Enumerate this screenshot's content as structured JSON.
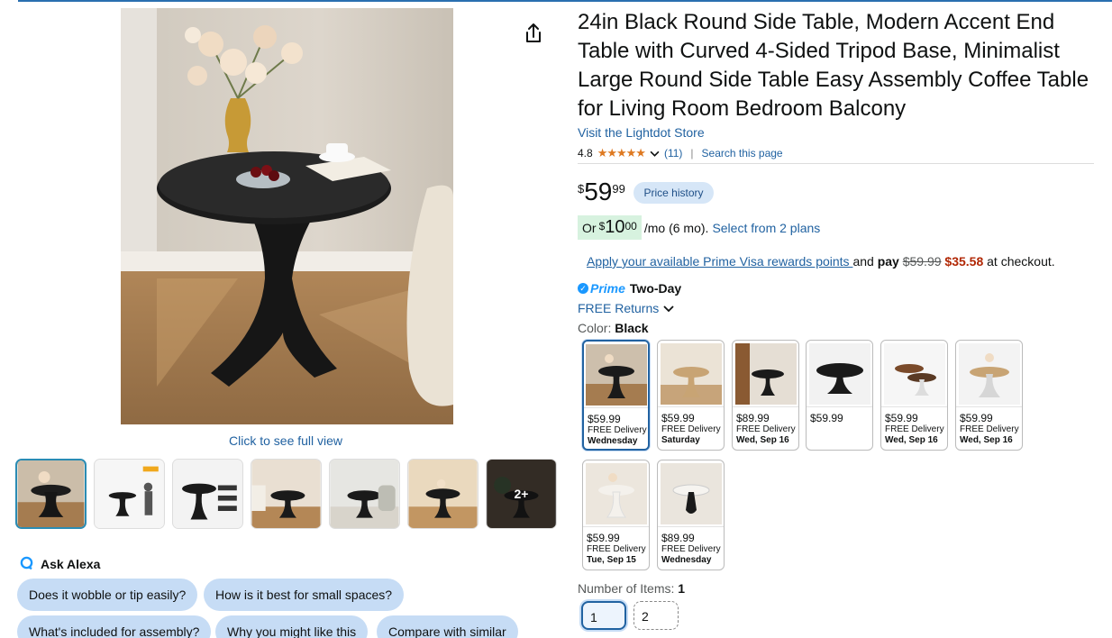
{
  "product": {
    "title": "24in Black Round Side Table, Modern Accent End Table with Curved 4-Sided Tripod Base, Minimalist Large Round Side Table Easy Assembly Coffee Table for Living Room Bedroom Balcony",
    "store_link": "Visit the Lightdot Store",
    "rating": "4.8",
    "stars": "★★★★★",
    "review_count": "(11)",
    "search_page": "Search this page",
    "price_symbol": "$",
    "price_whole": "59",
    "price_fraction": "99",
    "price_history": "Price history",
    "monthly_prefix": "Or",
    "monthly_symbol": "$",
    "monthly_whole": "10",
    "monthly_fraction": "00",
    "monthly_suffix": "/mo (6 mo).",
    "plans_link": "Select from 2 plans",
    "visa_link": "Apply your available Prime Visa rewards points ",
    "visa_and": "and ",
    "visa_pay": "pay",
    "visa_old": "$59.99",
    "visa_new": "$35.58",
    "visa_suffix": " at checkout.",
    "prime_label": "Prime",
    "prime_speed": "Two-Day",
    "returns": "FREE Returns",
    "color_label": "Color: ",
    "color_value": "Black",
    "items_label": "Number of Items: ",
    "items_value": "1"
  },
  "gallery": {
    "full_view": "Click to see full view",
    "more_label": "2+"
  },
  "alexa": {
    "label": "Ask Alexa",
    "chips": [
      "Does it wobble or tip easily?",
      "How is it best for small spaces?",
      "What's included for assembly?",
      "Why you might like this",
      "Compare with similar"
    ]
  },
  "swatches": [
    {
      "price": "$59.99",
      "delivery": "FREE Delivery",
      "date": "Wednesday"
    },
    {
      "price": "$59.99",
      "delivery": "FREE Delivery",
      "date": "Saturday"
    },
    {
      "price": "$89.99",
      "delivery": "FREE Delivery",
      "date": "Wed, Sep 16"
    },
    {
      "price": "$59.99",
      "delivery": "",
      "date": ""
    },
    {
      "price": "$59.99",
      "delivery": "FREE Delivery",
      "date": "Wed, Sep 16"
    },
    {
      "price": "$59.99",
      "delivery": "FREE Delivery",
      "date": "Wed, Sep 16"
    },
    {
      "price": "$59.99",
      "delivery": "FREE Delivery",
      "date": "Tue, Sep 15"
    },
    {
      "price": "$89.99",
      "delivery": "FREE Delivery",
      "date": "Wednesday"
    }
  ],
  "quantity": {
    "selected": "1",
    "option2": "2"
  },
  "colors": {
    "link": "#2162a1",
    "deal_red": "#b12704",
    "star": "#de7921",
    "prime": "#1a98ff"
  },
  "icons": {
    "share": "share-icon",
    "alexa": "alexa-icon",
    "chevron": "chevron-down-icon",
    "prime_check": "check-icon"
  }
}
